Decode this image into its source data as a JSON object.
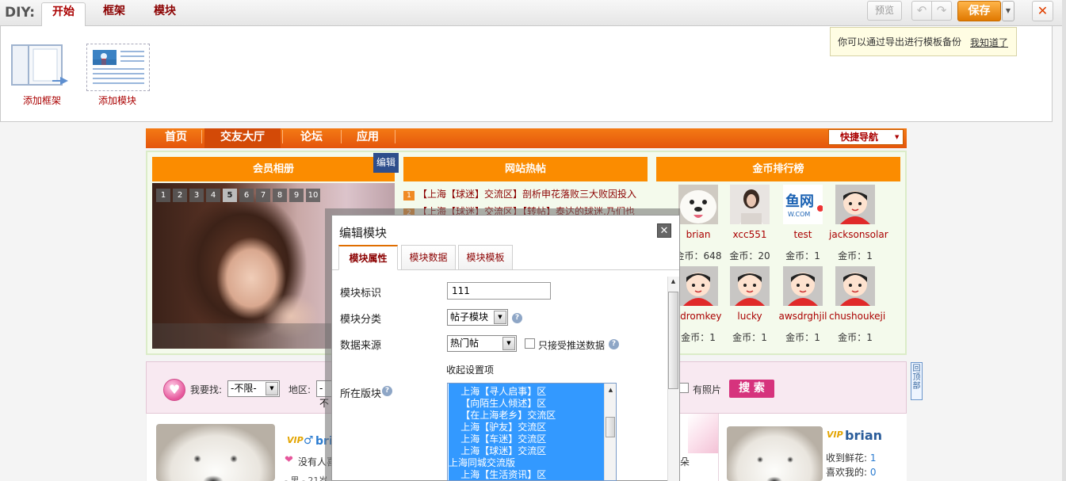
{
  "diy": {
    "label": "DIY:",
    "tabs": [
      "开始",
      "框架",
      "模块"
    ],
    "preview": "预览",
    "undo_icon": "↶",
    "redo_icon": "↷",
    "save": "保存",
    "dropdown_icon": "▼",
    "close_icon": "✕",
    "tip": "你可以通过导出进行模板备份",
    "tip_link": "我知道了",
    "add_frame": "添加框架",
    "add_module": "添加模块"
  },
  "nav": {
    "items": [
      "首页",
      "交友大厅",
      "论坛",
      "应用"
    ],
    "quick_nav": "快捷导航",
    "quick_nav_arrow": "▼"
  },
  "columns": {
    "album_title": "会员相册",
    "hot_title": "网站热帖",
    "gold_title": "金币排行榜",
    "edit": "编辑",
    "photo_pages": [
      "1",
      "2",
      "3",
      "4",
      "5",
      "6",
      "7",
      "8",
      "9",
      "10"
    ],
    "active_page": "5",
    "hot_posts": [
      {
        "num": "1",
        "text": "【上海【球迷】交流区】剖析申花落败三大败因投入"
      },
      {
        "num": "2",
        "text": "【上海【球迷】交流区】【转帖】泰达的球迷,乃们也"
      }
    ],
    "gold_prefix": "金币：",
    "members": [
      {
        "name": "brian",
        "gold": "648",
        "avatar": "dog-avatar"
      },
      {
        "name": "xcc551",
        "gold": "20",
        "avatar": "girl-avatar"
      },
      {
        "name": "test",
        "gold": "1",
        "avatar": "logo-avatar",
        "logo_text": "鱼网",
        "logo_sub": "W.COM"
      },
      {
        "name": "jacksonsolar",
        "gold": "1",
        "avatar": "cartoon-avatar"
      },
      {
        "name": "cdromkey",
        "gold": "1",
        "avatar": "cartoon-avatar"
      },
      {
        "name": "lucky",
        "gold": "1",
        "avatar": "cartoon-avatar"
      },
      {
        "name": "awsdrghjil",
        "gold": "1",
        "avatar": "cartoon-avatar"
      },
      {
        "name": "chushoukeji",
        "gold": "1",
        "avatar": "cartoon-avatar"
      }
    ]
  },
  "search": {
    "heart_icon": "♥",
    "looking_for": "我要找:",
    "any": "-不限-",
    "arrow_icon": "▼",
    "region": "地区:",
    "region_value": "-不",
    "has_photo": "有照片",
    "button": "搜 索",
    "back_top": "回顶部"
  },
  "cards": {
    "left": {
      "vip": "VIP",
      "male_icon": "♂",
      "name": "bri",
      "heart_icon": "❤",
      "nobody": "没有人喜",
      "gender_age": "- 男 - 21岁"
    },
    "flower_frag": "朵",
    "right": {
      "vip": "VIP",
      "name": "brian",
      "flowers_label": "收到鲜花:",
      "flowers": "1",
      "likes_label": "喜欢我的:",
      "likes": "0"
    }
  },
  "dialog": {
    "title": "编辑模块",
    "close_icon": "✕",
    "tabs": [
      "模块属性",
      "模块数据",
      "模块模板"
    ],
    "label_id": "模块标识",
    "id_value": "111",
    "label_category": "模块分类",
    "category_value": "帖子模块",
    "label_source": "数据来源",
    "source_value": "热门帖",
    "push_only": "只接受推送数据",
    "collapse_settings": "收起设置项",
    "label_forum": "所在版块",
    "help_icon": "?",
    "arrow_icon": "▼",
    "scroll_up_icon": "▲",
    "forums": [
      "    上海【寻人启事】区",
      "    【向陌生人倾述】区",
      "    【在上海老乡】交流区",
      "    上海【驴友】交流区",
      "    上海【车迷】交流区",
      "    上海【球迷】交流区",
      "上海同城交流版",
      "    上海【生活资讯】区"
    ]
  }
}
